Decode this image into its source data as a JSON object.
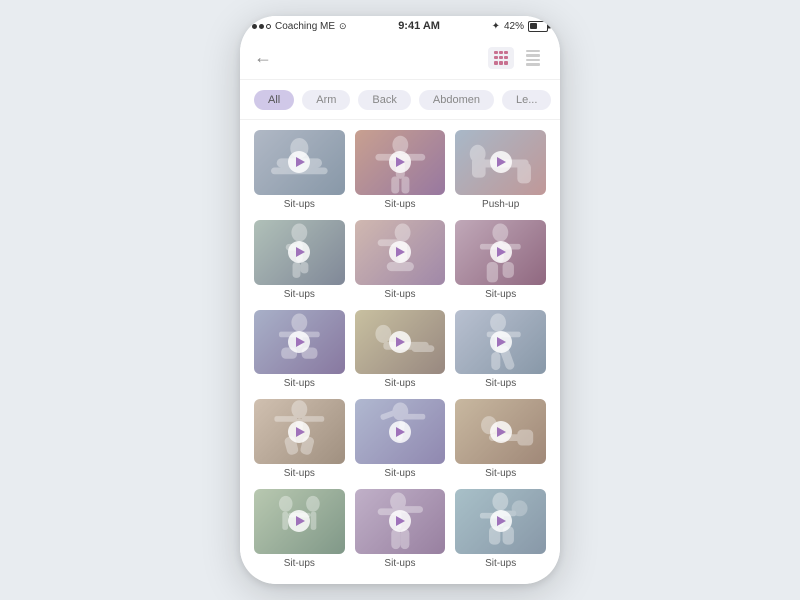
{
  "status": {
    "carrier": "Coaching ME",
    "wifi": "WiFi",
    "time": "9:41 AM",
    "bluetooth": "42%",
    "battery": 42
  },
  "nav": {
    "back_label": "←",
    "title": ""
  },
  "filters": [
    {
      "id": "all",
      "label": "All",
      "selected": true
    },
    {
      "id": "arm",
      "label": "Arm",
      "selected": false
    },
    {
      "id": "back",
      "label": "Back",
      "selected": false
    },
    {
      "id": "abdomen",
      "label": "Abdomen",
      "selected": false
    },
    {
      "id": "legs",
      "label": "Le...",
      "selected": false
    }
  ],
  "exercises": [
    {
      "label": "Sit-ups",
      "thumb_class": "t1"
    },
    {
      "label": "Sit-ups",
      "thumb_class": "t2"
    },
    {
      "label": "Push-up",
      "thumb_class": "t3"
    },
    {
      "label": "Sit-ups",
      "thumb_class": "t4"
    },
    {
      "label": "Sit-ups",
      "thumb_class": "t5"
    },
    {
      "label": "Sit-ups",
      "thumb_class": "t6"
    },
    {
      "label": "Sit-ups",
      "thumb_class": "t7"
    },
    {
      "label": "Sit-ups",
      "thumb_class": "t8"
    },
    {
      "label": "Sit-ups",
      "thumb_class": "t9"
    },
    {
      "label": "Sit-ups",
      "thumb_class": "t10"
    },
    {
      "label": "Sit-ups",
      "thumb_class": "t11"
    },
    {
      "label": "Sit-ups",
      "thumb_class": "t12"
    },
    {
      "label": "Sit-ups",
      "thumb_class": "t13"
    },
    {
      "label": "Sit-ups",
      "thumb_class": "t14"
    },
    {
      "label": "Sit-ups",
      "thumb_class": "t15"
    }
  ],
  "view_toggle": {
    "grid_label": "grid view",
    "list_label": "list view"
  }
}
